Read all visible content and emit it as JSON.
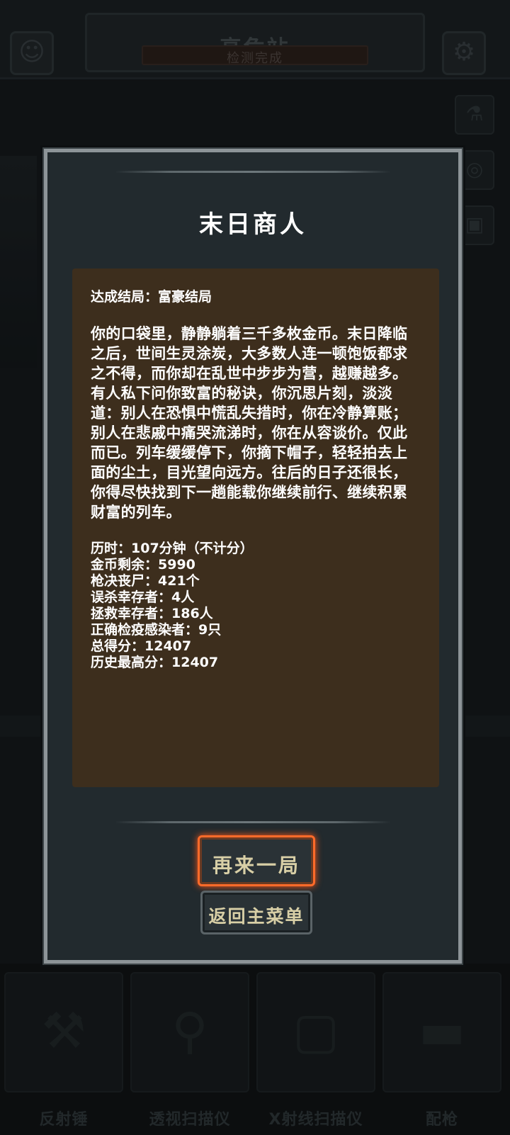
{
  "background": {
    "station_title": "高危站",
    "status": "检测完成",
    "left_icon": "add-person-icon",
    "right_icon": "gear-icon",
    "side_icons": [
      "microscope-icon",
      "radar-icon",
      "scanner-icon"
    ],
    "toolbar": [
      {
        "label": "反射锤",
        "icon": "hammer-icon"
      },
      {
        "label": "透视扫描仪",
        "icon": "magnifier-icon"
      },
      {
        "label": "X射线扫描仪",
        "icon": "xray-frame-icon"
      },
      {
        "label": "配枪",
        "icon": "pistol-icon"
      }
    ]
  },
  "modal": {
    "title": "末日商人",
    "ending": "达成结局：富豪结局",
    "story": "你的口袋里，静静躺着三千多枚金币。末日降临之后，世间生灵涂炭，大多数人连一顿饱饭都求之不得，而你却在乱世中步步为营，越赚越多。有人私下问你致富的秘诀，你沉思片刻，淡淡道：别人在恐惧中慌乱失措时，你在冷静算账；别人在悲戚中痛哭流涕时，你在从容谈价。仅此而已。列车缓缓停下，你摘下帽子，轻轻拍去上面的尘土，目光望向远方。往后的日子还很长，你得尽快找到下一趟能载你继续前行、继续积累财富的列车。",
    "stats": [
      "历时：107分钟（不计分）",
      "金币剩余：5990",
      "枪决丧尸：421个",
      "误杀幸存者：4人",
      "拯救幸存者：186人",
      "正确检疫感染者：9只",
      "总得分：12407",
      "历史最高分：12407"
    ],
    "play_again": "再来一局",
    "main_menu": "返回主菜单",
    "accent_color": "#ff6b2a",
    "panel_color": "#3d2e1d"
  }
}
